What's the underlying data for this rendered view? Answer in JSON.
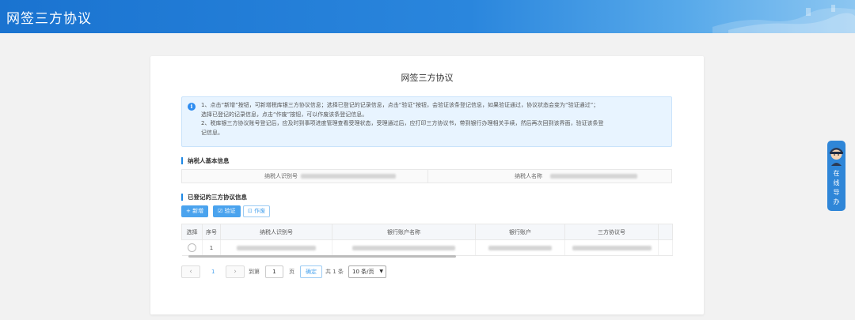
{
  "header": {
    "title": "网签三方协议"
  },
  "card": {
    "title": "网签三方协议"
  },
  "notice": {
    "line1": "1、点击“新增”按钮，可新增税库银三方协议信息；选择已登记的记录信息，点击“验证”按钮，会验证该条登记信息，如果验证通过，协议状态会变为“验证通过”；",
    "line2": "选择已登记的记录信息，点击“作废”按钮，可以作废该条登记信息。",
    "line3": "2、税库银三方协议账号登记后，应及时到事项进度管理查看受理状态，受理通过后，应打印三方协议书，带到银行办理相关手续，然后再次回到该界面，验证该条登",
    "line4": "记信息。"
  },
  "taxpayer_section": {
    "title": "纳税人基本信息",
    "id_label": "纳税人识别号",
    "name_label": "纳税人名称"
  },
  "registered_section": {
    "title": "已登记的三方协议信息",
    "buttons": {
      "add": "+ 新增",
      "verify": "☑ 验证",
      "void": "⊡ 作废"
    }
  },
  "table": {
    "headers": [
      "选择",
      "序号",
      "纳税人识别号",
      "银行账户名称",
      "银行账户",
      "三方协议号"
    ],
    "rows": [
      {
        "index": "1"
      }
    ]
  },
  "pagination": {
    "current_page": "1",
    "goto_prefix": "到第",
    "goto_value": "1",
    "page_suffix": "页",
    "confirm": "确定",
    "total": "共 1 条",
    "page_size": "10 条/页"
  },
  "side_widget": {
    "label": "在\n线\n导\n办"
  },
  "colors": {
    "primary": "#1e88e5",
    "button": "#4aa3ee",
    "notice_bg": "#e8f4ff"
  }
}
